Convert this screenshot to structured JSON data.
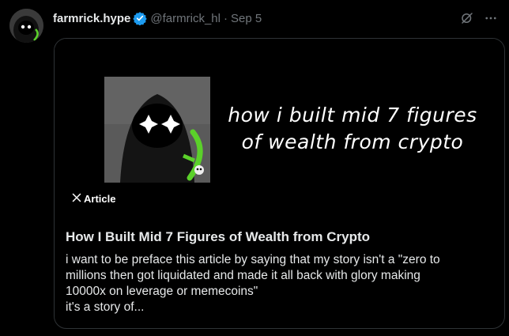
{
  "post": {
    "display_name": "farmrick.hype",
    "handle": "@farmrick_hl",
    "separator": "·",
    "date": "Sep 5"
  },
  "icons": {
    "verified": "verified-badge-icon",
    "grok": "grok-icon",
    "more": "more-icon",
    "x_logo": "x-logo-icon"
  },
  "colors": {
    "verified": "#1d9bf0",
    "muted": "#71767b",
    "text": "#e7e9ea",
    "border": "#2f3336",
    "accent_green": "#5bd12a"
  },
  "card": {
    "media_headline": "how i built mid 7 figures\nof wealth from crypto",
    "badge_label": "Article",
    "title": "How I Built Mid 7 Figures of Wealth from Crypto",
    "snippet": "i want to be preface this article by saying that my story isn't a \"zero to\nmillions then got liquidated and made it all back with glory making\n10000x on leverage or memecoins\"\nit's a story of..."
  }
}
